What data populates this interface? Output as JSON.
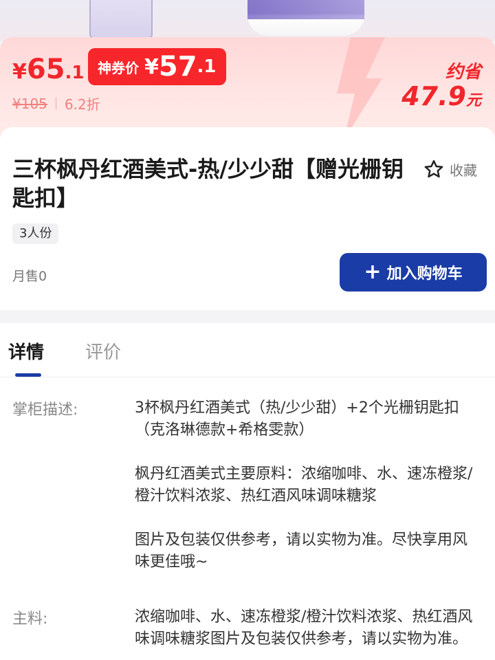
{
  "price": {
    "current_symbol": "¥",
    "current_integer": "65",
    "current_decimal": ".1",
    "coupon_label": "神券价",
    "coupon_symbol": "¥",
    "coupon_integer": "57",
    "coupon_decimal": ".1",
    "original": "¥105",
    "discount": "6.2折",
    "save_label": "约省",
    "save_amount": "47.9",
    "save_unit": "元"
  },
  "product": {
    "title": "三杯枫丹红酒美式-热/少少甜【赠光栅钥匙扣】",
    "favorite_label": "收藏",
    "serving_tag": "3人份",
    "monthly_sales": "月售0",
    "add_to_cart_label": "加入购物车"
  },
  "tabs": [
    {
      "label": "详情"
    },
    {
      "label": "评价"
    }
  ],
  "details": [
    {
      "label": "掌柜描述:",
      "text": "3杯枫丹红酒美式（热/少少甜）+2个光栅钥匙扣（克洛琳德款+希格雯款）\n\n枫丹红酒美式主要原料：浓缩咖啡、水、速冻橙浆/橙汁饮料浓浆、热红酒风味调味糖浆\n\n图片及包装仅供参考，请以实物为准。尽快享用风味更佳哦~"
    },
    {
      "label": "主料:",
      "text": "浓缩咖啡、水、速冻橙浆/橙汁饮料浓浆、热红酒风味调味糖浆图片及包装仅供参考，请以实物为准。"
    }
  ],
  "colors": {
    "accent_red": "#f0262c",
    "brand_blue": "#1a3ca6"
  }
}
